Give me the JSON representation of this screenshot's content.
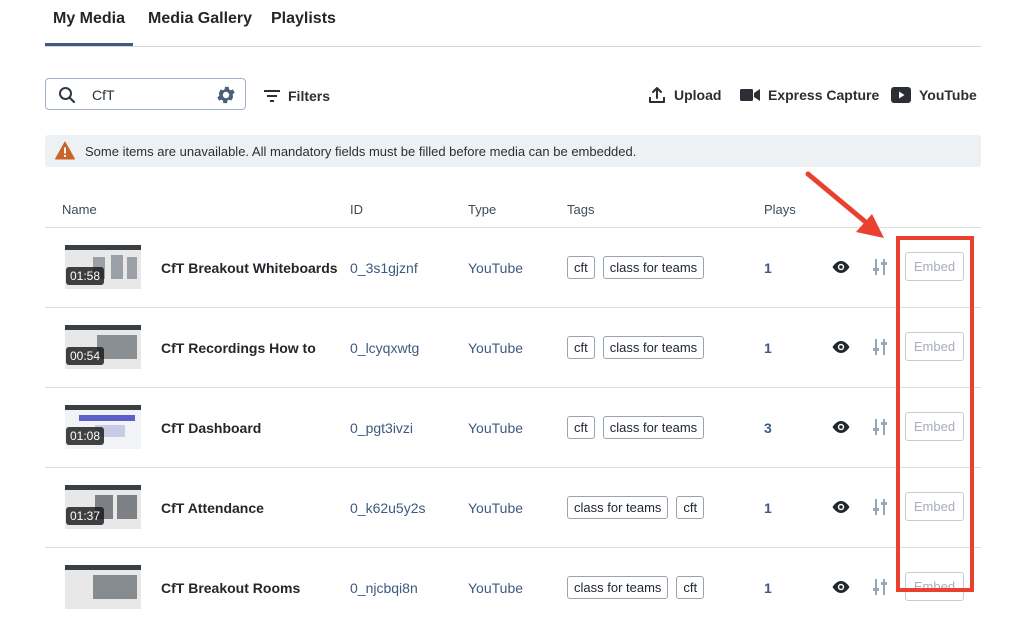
{
  "tabs": [
    {
      "label": "My Media",
      "active": true
    },
    {
      "label": "Media Gallery",
      "active": false
    },
    {
      "label": "Playlists",
      "active": false
    }
  ],
  "search": {
    "value": "CfT",
    "icon": "search-icon",
    "settings_icon": "gear-icon"
  },
  "filters": {
    "label": "Filters",
    "icon": "filter-lines-icon"
  },
  "actions": {
    "upload": {
      "label": "Upload",
      "icon": "upload-icon"
    },
    "express_capture": {
      "label": "Express Capture",
      "icon": "video-camera-icon"
    },
    "youtube": {
      "label": "YouTube",
      "icon": "youtube-icon"
    }
  },
  "alert": {
    "icon": "warning-icon",
    "text": "Some items are unavailable. All mandatory fields must be filled before media can be embedded."
  },
  "table": {
    "headers": {
      "name": "Name",
      "id": "ID",
      "type": "Type",
      "tags": "Tags",
      "plays": "Plays"
    },
    "embed_label": "Embed",
    "rows": [
      {
        "duration": "01:58",
        "name": "CfT Breakout Whiteboards",
        "id": "0_3s1gjznf",
        "type": "YouTube",
        "tags": [
          "cft",
          "class for teams"
        ],
        "plays": "1"
      },
      {
        "duration": "00:54",
        "name": "CfT Recordings How to",
        "id": "0_lcyqxwtg",
        "type": "YouTube",
        "tags": [
          "cft",
          "class for teams"
        ],
        "plays": "1"
      },
      {
        "duration": "01:08",
        "name": "CfT Dashboard",
        "id": "0_pgt3ivzi",
        "type": "YouTube",
        "tags": [
          "cft",
          "class for teams"
        ],
        "plays": "3"
      },
      {
        "duration": "01:37",
        "name": "CfT Attendance",
        "id": "0_k62u5y2s",
        "type": "YouTube",
        "tags": [
          "class for teams",
          "cft"
        ],
        "plays": "1"
      },
      {
        "duration": "",
        "name": "CfT Breakout Rooms",
        "id": "0_njcbqi8n",
        "type": "YouTube",
        "tags": [
          "class for teams",
          "cft"
        ],
        "plays": "1"
      }
    ]
  },
  "colors": {
    "accent": "#3d5a80",
    "annotation": "#e8412f",
    "warning": "#c9642a"
  }
}
